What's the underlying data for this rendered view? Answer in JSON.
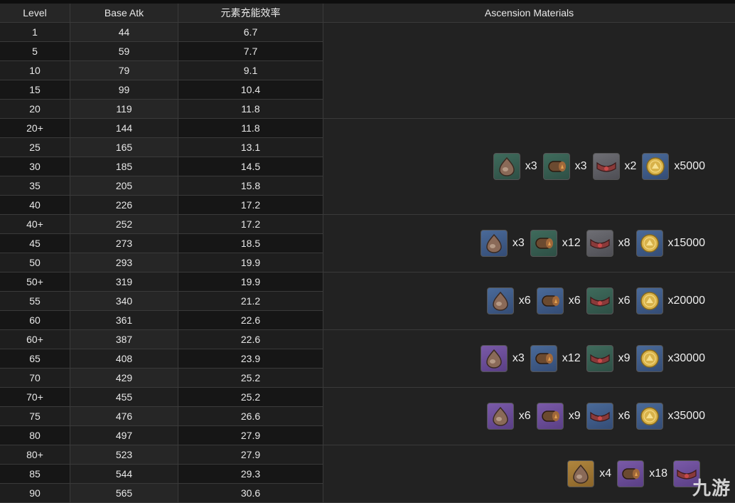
{
  "headers": {
    "level": "Level",
    "base_atk": "Base Atk",
    "energy_recharge": "元素充能效率",
    "materials": "Ascension Materials"
  },
  "rows": [
    {
      "level": "1",
      "atk": "44",
      "er": "6.7"
    },
    {
      "level": "5",
      "atk": "59",
      "er": "7.7"
    },
    {
      "level": "10",
      "atk": "79",
      "er": "9.1"
    },
    {
      "level": "15",
      "atk": "99",
      "er": "10.4"
    },
    {
      "level": "20",
      "atk": "119",
      "er": "11.8"
    },
    {
      "level": "20+",
      "atk": "144",
      "er": "11.8"
    },
    {
      "level": "25",
      "atk": "165",
      "er": "13.1"
    },
    {
      "level": "30",
      "atk": "185",
      "er": "14.5"
    },
    {
      "level": "35",
      "atk": "205",
      "er": "15.8"
    },
    {
      "level": "40",
      "atk": "226",
      "er": "17.2"
    },
    {
      "level": "40+",
      "atk": "252",
      "er": "17.2"
    },
    {
      "level": "45",
      "atk": "273",
      "er": "18.5"
    },
    {
      "level": "50",
      "atk": "293",
      "er": "19.9"
    },
    {
      "level": "50+",
      "atk": "319",
      "er": "19.9"
    },
    {
      "level": "55",
      "atk": "340",
      "er": "21.2"
    },
    {
      "level": "60",
      "atk": "361",
      "er": "22.6"
    },
    {
      "level": "60+",
      "atk": "387",
      "er": "22.6"
    },
    {
      "level": "65",
      "atk": "408",
      "er": "23.9"
    },
    {
      "level": "70",
      "atk": "429",
      "er": "25.2"
    },
    {
      "level": "70+",
      "atk": "455",
      "er": "25.2"
    },
    {
      "level": "75",
      "atk": "476",
      "er": "26.6"
    },
    {
      "level": "80",
      "atk": "497",
      "er": "27.9"
    },
    {
      "level": "80+",
      "atk": "523",
      "er": "27.9"
    },
    {
      "level": "85",
      "atk": "544",
      "er": "29.3"
    },
    {
      "level": "90",
      "atk": "565",
      "er": "30.6"
    }
  ],
  "ascension_groups": [
    {
      "items": []
    },
    {
      "items": [
        {
          "icon": "gem-icon",
          "rarity": "r2",
          "qty": "x3"
        },
        {
          "icon": "scroll-icon",
          "rarity": "r2",
          "qty": "x3"
        },
        {
          "icon": "crystal-icon",
          "rarity": "crystal",
          "qty": "x2"
        },
        {
          "icon": "coin-icon",
          "rarity": "coin",
          "qty": "x5000"
        }
      ]
    },
    {
      "items": [
        {
          "icon": "gem-icon",
          "rarity": "r3",
          "qty": "x3"
        },
        {
          "icon": "scroll-icon",
          "rarity": "r2",
          "qty": "x12"
        },
        {
          "icon": "crystal-icon",
          "rarity": "crystal",
          "qty": "x8"
        },
        {
          "icon": "coin-icon",
          "rarity": "coin",
          "qty": "x15000"
        }
      ]
    },
    {
      "items": [
        {
          "icon": "gem-icon",
          "rarity": "r3",
          "qty": "x6"
        },
        {
          "icon": "scroll-icon",
          "rarity": "r3",
          "qty": "x6"
        },
        {
          "icon": "crystal-icon",
          "rarity": "r2",
          "qty": "x6"
        },
        {
          "icon": "coin-icon",
          "rarity": "coin",
          "qty": "x20000"
        }
      ]
    },
    {
      "items": [
        {
          "icon": "gem-icon",
          "rarity": "r4",
          "qty": "x3"
        },
        {
          "icon": "scroll-icon",
          "rarity": "r3",
          "qty": "x12"
        },
        {
          "icon": "crystal-icon",
          "rarity": "r2",
          "qty": "x9"
        },
        {
          "icon": "coin-icon",
          "rarity": "coin",
          "qty": "x30000"
        }
      ]
    },
    {
      "items": [
        {
          "icon": "gem-icon",
          "rarity": "r4",
          "qty": "x6"
        },
        {
          "icon": "scroll-icon",
          "rarity": "r4",
          "qty": "x9"
        },
        {
          "icon": "crystal-icon",
          "rarity": "r3",
          "qty": "x6"
        },
        {
          "icon": "coin-icon",
          "rarity": "coin",
          "qty": "x35000"
        }
      ]
    },
    {
      "items": [
        {
          "icon": "gem-icon",
          "rarity": "r5",
          "qty": "x4"
        },
        {
          "icon": "scroll-icon",
          "rarity": "r4",
          "qty": "x18"
        },
        {
          "icon": "crystal-icon",
          "rarity": "r4",
          "qty": ""
        }
      ]
    }
  ],
  "watermark": "九游"
}
